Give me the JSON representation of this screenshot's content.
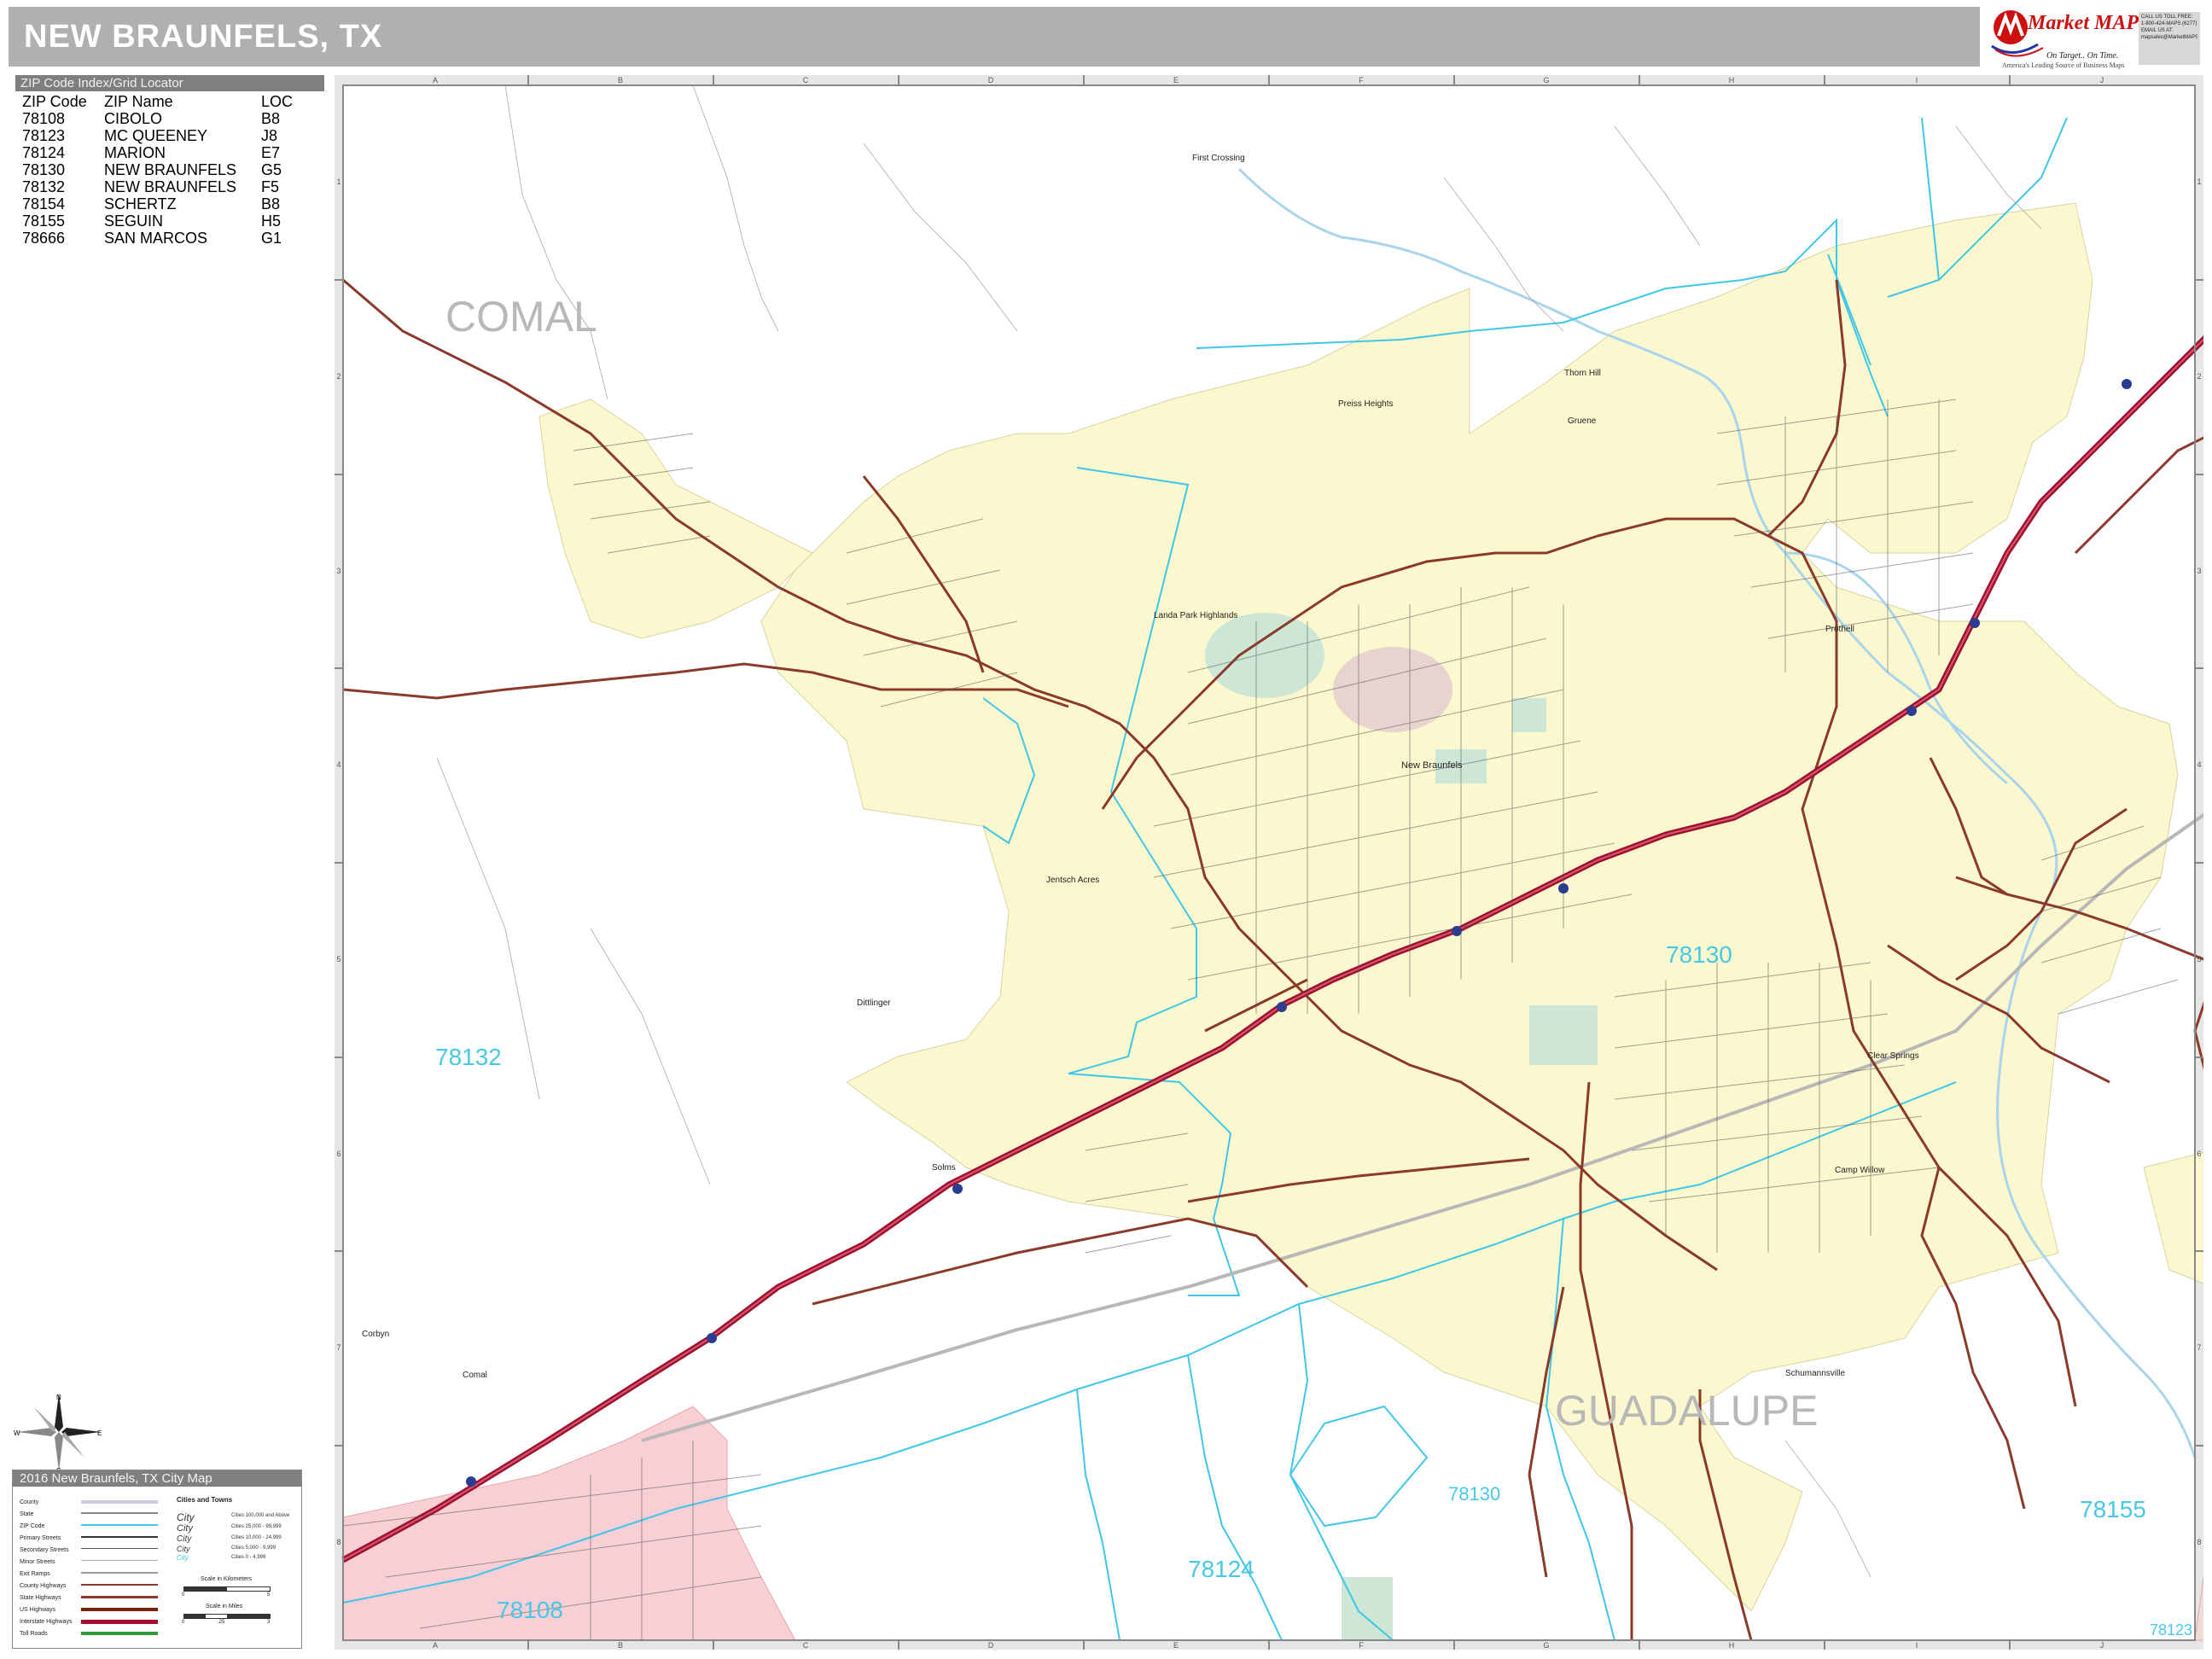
{
  "header": {
    "title": "NEW BRAUNFELS, TX"
  },
  "logo": {
    "company": "Market MAPS",
    "tagline": "On Target.. On Time.",
    "subline": "America's Leading Source of Business Maps",
    "contact": [
      "CALL US TOLL FREE:",
      "1-800-424-MAPS (6277)",
      "EMAIL US AT:",
      "mapsales@MarketMAPS.com"
    ]
  },
  "zip_index": {
    "title": "ZIP Code Index/Grid Locator",
    "columns": [
      "ZIP Code",
      "ZIP Name",
      "LOC"
    ],
    "rows": [
      [
        "78108",
        "CIBOLO",
        "B8"
      ],
      [
        "78123",
        "MC QUEENEY",
        "J8"
      ],
      [
        "78124",
        "MARION",
        "E7"
      ],
      [
        "78130",
        "NEW BRAUNFELS",
        "G5"
      ],
      [
        "78132",
        "NEW BRAUNFELS",
        "F5"
      ],
      [
        "78154",
        "SCHERTZ",
        "B8"
      ],
      [
        "78155",
        "SEGUIN",
        "H5"
      ],
      [
        "78666",
        "SAN MARCOS",
        "G1"
      ]
    ]
  },
  "grid": {
    "columns": [
      "A",
      "B",
      "C",
      "D",
      "E",
      "F",
      "G",
      "H",
      "I",
      "J"
    ],
    "rows": [
      "1",
      "2",
      "3",
      "4",
      "5",
      "6",
      "7",
      "8"
    ]
  },
  "map": {
    "counties": [
      "COMAL",
      "GUADALUPE"
    ],
    "zip_labels": [
      "78132",
      "78130",
      "78130",
      "78124",
      "78108",
      "78155",
      "78123"
    ],
    "places": [
      "First Crossing",
      "Preiss Heights",
      "Thorn Hill",
      "Gruene",
      "Landa Park Highlands",
      "New Braunfels",
      "Prothell",
      "Jentsch Acres",
      "Dittlinger",
      "Solms",
      "Clear Springs",
      "Camp Willow",
      "Schumannsville",
      "Corbyn",
      "Comal"
    ]
  },
  "legend": {
    "title": "2016 New Braunfels, TX City Map",
    "items": [
      "County",
      "State",
      "ZIP Code",
      "Primary Streets",
      "Secondary Streets",
      "Minor Streets",
      "Exit Ramps",
      "County Highways",
      "State Highways",
      "US Highways",
      "Interstate Highways",
      "Toll Roads"
    ],
    "cities_heading": "Cities and Towns",
    "city_samples": [
      "City",
      "City",
      "City",
      "City",
      "City"
    ],
    "pop_samples": [
      "Cities 100,000 and Above",
      "Cities 25,000 - 99,999",
      "Cities 10,000 - 24,999",
      "Cities 5,000 - 9,999",
      "Cities 0 - 4,999"
    ],
    "scale_km": "Scale in Kilometers",
    "scale_miles": "Scale in Miles",
    "scale_km_ticks": [
      "0",
      "5"
    ],
    "scale_mi_ticks": [
      "0",
      ".25",
      "3"
    ]
  },
  "colors": {
    "city_fill": "#fbf8cf",
    "pink_area": "#f7cfd4",
    "airport": "#c8c8c8",
    "zip_line": "#3fc6e8",
    "interstate": "#a1102e",
    "highway": "#8b3a2a",
    "county_label": "#b8b8b8",
    "zip_label": "#46c8e6"
  }
}
